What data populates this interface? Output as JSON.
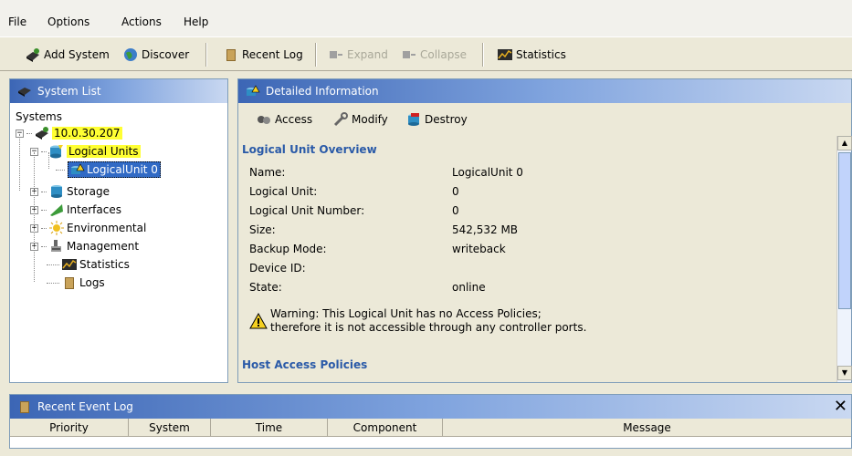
{
  "menu": {
    "file": "File",
    "options": "Options",
    "actions": "Actions",
    "help": "Help"
  },
  "toolbar": {
    "add_system": "Add System",
    "discover": "Discover",
    "recent_log": "Recent Log",
    "expand": "Expand",
    "collapse": "Collapse",
    "statistics": "Statistics"
  },
  "system_list": {
    "title": "System List",
    "root_label": "Systems",
    "system_ip": "10.0.30.207",
    "logical_units": "Logical Units",
    "logical_unit_0": "LogicalUnit 0",
    "storage": "Storage",
    "interfaces": "Interfaces",
    "environmental": "Environmental",
    "management": "Management",
    "statistics": "Statistics",
    "logs": "Logs"
  },
  "detail": {
    "title": "Detailed Information",
    "actions": {
      "access": "Access",
      "modify": "Modify",
      "destroy": "Destroy"
    },
    "overview_heading": "Logical Unit Overview",
    "rows": [
      {
        "key": "Name:",
        "value": "LogicalUnit 0"
      },
      {
        "key": "Logical Unit:",
        "value": "0"
      },
      {
        "key": "Logical Unit Number:",
        "value": "0"
      },
      {
        "key": "Size:",
        "value": "542,532 MB"
      },
      {
        "key": "Backup Mode:",
        "value": "writeback"
      },
      {
        "key": "Device ID:",
        "value": ""
      },
      {
        "key": "State:",
        "value": "online"
      }
    ],
    "warning_line1": "Warning: This Logical Unit has no Access Policies;",
    "warning_line2": "therefore it is not accessible through any controller ports.",
    "host_access_heading": "Host Access Policies"
  },
  "event_log": {
    "title": "Recent Event Log",
    "close_glyph": "✕",
    "columns": [
      "Priority",
      "System",
      "Time",
      "Component",
      "Message"
    ]
  },
  "colors": {
    "highlight_yellow": "#ffff33",
    "selection_blue": "#316ac5",
    "heading_blue": "#2a5aa8",
    "header_gradient_start": "#3c66b5"
  }
}
